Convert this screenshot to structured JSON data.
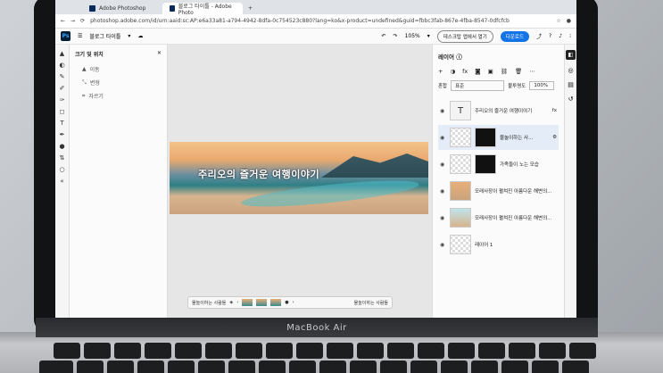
{
  "browser": {
    "tabs": [
      {
        "label": "Adobe Photoshop"
      },
      {
        "label": "블로그 타이틀 - Adobe Photo"
      }
    ],
    "address": "photoshop.adobe.com/id/urn:aaid:sc:AP:e6a33a81-a794-4942-8dfa-0c754523c880?lang=ko&x-product=undefined&guid=fbbc3fab-867e-4fba-8547-0dfcfcb"
  },
  "app": {
    "logo": "Ps",
    "document_title": "블로그 타이틀",
    "zoom": "105%",
    "share_label": "데스크탑 앱에서 열기",
    "download_label": "다운로드"
  },
  "toolbar": {
    "tools": [
      "move-icon",
      "select-icon",
      "lasso-icon",
      "brush-icon",
      "eraser-icon",
      "crop-icon",
      "text-icon",
      "eyedropper-icon",
      "color-swatch-icon",
      "more-icon"
    ]
  },
  "properties": {
    "title": "크기 및 위치",
    "items": [
      "이동",
      "변형",
      "자르기"
    ]
  },
  "canvas": {
    "artwork_title": "주리오의 즐거운 여행이야기"
  },
  "bottombar": {
    "left_label": "물놀이하는 사람들",
    "right_label": "물놀이하는 사람들"
  },
  "layers": {
    "title": "레이어",
    "blend_label": "혼합",
    "blend_value": "표준",
    "opacity_label": "불투명도",
    "opacity_value": "100%",
    "rows": [
      {
        "name": "주리오의 즐거운 여행이야기",
        "thumb": "T",
        "active": false,
        "suffix": "fx"
      },
      {
        "name": "물놀이하는 사...",
        "thumb": "",
        "active": true,
        "suffix": ""
      },
      {
        "name": "가족들이 노는 모습",
        "thumb": "",
        "active": false,
        "suffix": ""
      },
      {
        "name": "모래사장이 펼쳐진 아름다운 해변의...",
        "thumb": "",
        "active": false,
        "suffix": ""
      },
      {
        "name": "모래사장이 펼쳐진 아름다운 해변의...",
        "thumb": "",
        "active": false,
        "suffix": ""
      },
      {
        "name": "레이어 1",
        "thumb": "",
        "active": false,
        "suffix": ""
      }
    ]
  },
  "laptop": {
    "brand": "MacBook Air"
  },
  "colors": {
    "accent": "#1473e6",
    "ps_dark": "#001e36",
    "ps_blue": "#31a8ff"
  }
}
